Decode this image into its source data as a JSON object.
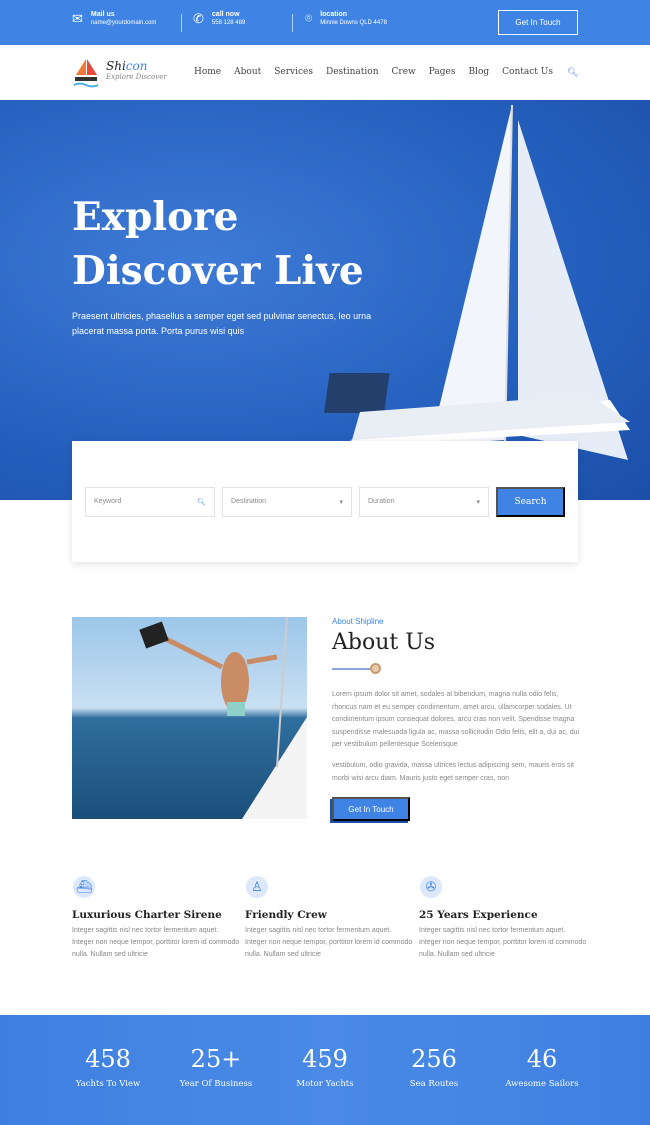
{
  "topbar": {
    "mail_label": "Mail us",
    "mail_value": "name@yourdomain.com",
    "call_label": "call now",
    "call_value": "558 128 489",
    "location_label": "location",
    "location_value": "Minnie Downs QLD 4478",
    "cta": "Get In Touch"
  },
  "nav": {
    "brand": "Shi",
    "brand_accent": "con",
    "tagline": "Explore Discover",
    "items": [
      "Home",
      "About",
      "Services",
      "Destination",
      "Crew",
      "Pages",
      "Blog",
      "Contact Us"
    ]
  },
  "hero": {
    "title_line1": "Explore",
    "title_line2": "Discover Live",
    "text": "Praesent ultricies, phasellus a semper eget sed pulvinar senectus, leo urna placerat massa porta. Porta purus wisi quis"
  },
  "search": {
    "keyword_placeholder": "Keyword",
    "destination": "Destination",
    "duration": "Duration",
    "button": "Search"
  },
  "about": {
    "kicker": "About Shipline",
    "title": "About Us",
    "p1": "Lorem ipsum dolor sit amet, sodales at bibendum, magna nulla odio felis, rhoncus nam et eu semper condimentum, amet arcu, ullamcorper sodales. Ut condimentum ipsum consequat dolores, arcu cras non velit. Spendisse magna suspendisse malesuada ligula ac, massa sollicitudin Odio felis, elit a, dui ac, dui per vestibulum pellentesque Scelerisque",
    "p2": "vestibulum, odio gravida, massa ultrices lectus adipiscing sem, mauris eros sit morbi wisi arcu diam. Mauris justo eget semper cras, non",
    "button": "Get In Touch"
  },
  "features": [
    {
      "title": "Luxurious Charter Sirene",
      "text": "Integer sagittis nisl nec tortor fermentum aquet. Integer non neque tempor, porttitor lorem id commodo nulla. Nullam sed ultricie",
      "icon": "ship-icon"
    },
    {
      "title": "Friendly Crew",
      "text": "Integer sagittis nisl nec tortor fermentum aquet. Integer non neque tempor, porttitor lorem id commodo nulla. Nullam sed ultricie",
      "icon": "captain-icon"
    },
    {
      "title": "25 Years Experience",
      "text": "Integer sagittis nisl nec tortor fermentum aquet. Integer non neque tempor, porttitor lorem id commodo nulla. Nullam sed ultricie",
      "icon": "helm-icon"
    }
  ],
  "stats": [
    {
      "n": "458",
      "l": "Yachts To View"
    },
    {
      "n": "25+",
      "l": "Year Of Business"
    },
    {
      "n": "459",
      "l": "Motor Yachts"
    },
    {
      "n": "256",
      "l": "Sea Routes"
    },
    {
      "n": "46",
      "l": "Awesome Sailors"
    }
  ],
  "colors": {
    "accent": "#3f84e5"
  }
}
